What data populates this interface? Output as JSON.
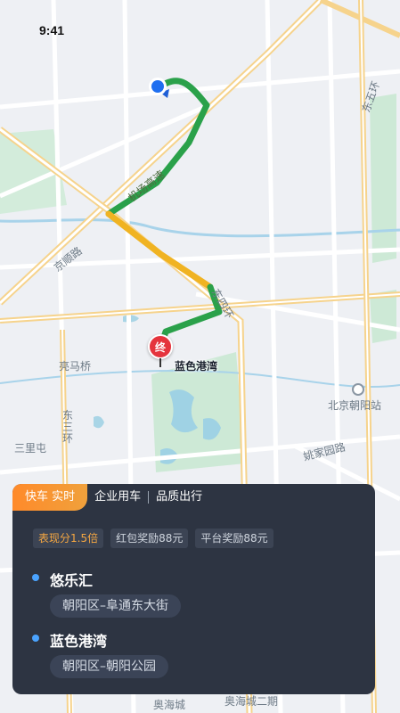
{
  "status_bar": {
    "time": "9:41"
  },
  "map": {
    "labels": {
      "road_1": "机场高速",
      "road_2": "京顺路",
      "road_3": "东四环",
      "road_4": "东五环",
      "road_5": "亮马桥",
      "road_6": "姚家园路",
      "road_7": "东三环",
      "road_8": "三里屯",
      "road_9": "奥海城二期",
      "poi_1": "北京朝阳站",
      "poi_2": "奥海城"
    },
    "end_marker": "终",
    "destination_label": "蓝色港湾",
    "route_colors": {
      "smooth": "#2aa14a",
      "slow": "#f0b322"
    }
  },
  "order_card": {
    "tabs": [
      "快车 实时",
      "企业用车",
      "品质出行"
    ],
    "tags": [
      "表现分1.5倍",
      "红包奖励88元",
      "平台奖励88元"
    ],
    "pickup": {
      "name": "悠乐汇",
      "address": "朝阳区–阜通东大街"
    },
    "dropoff": {
      "name": "蓝色港湾",
      "address": "朝阳区–朝阳公园"
    }
  }
}
